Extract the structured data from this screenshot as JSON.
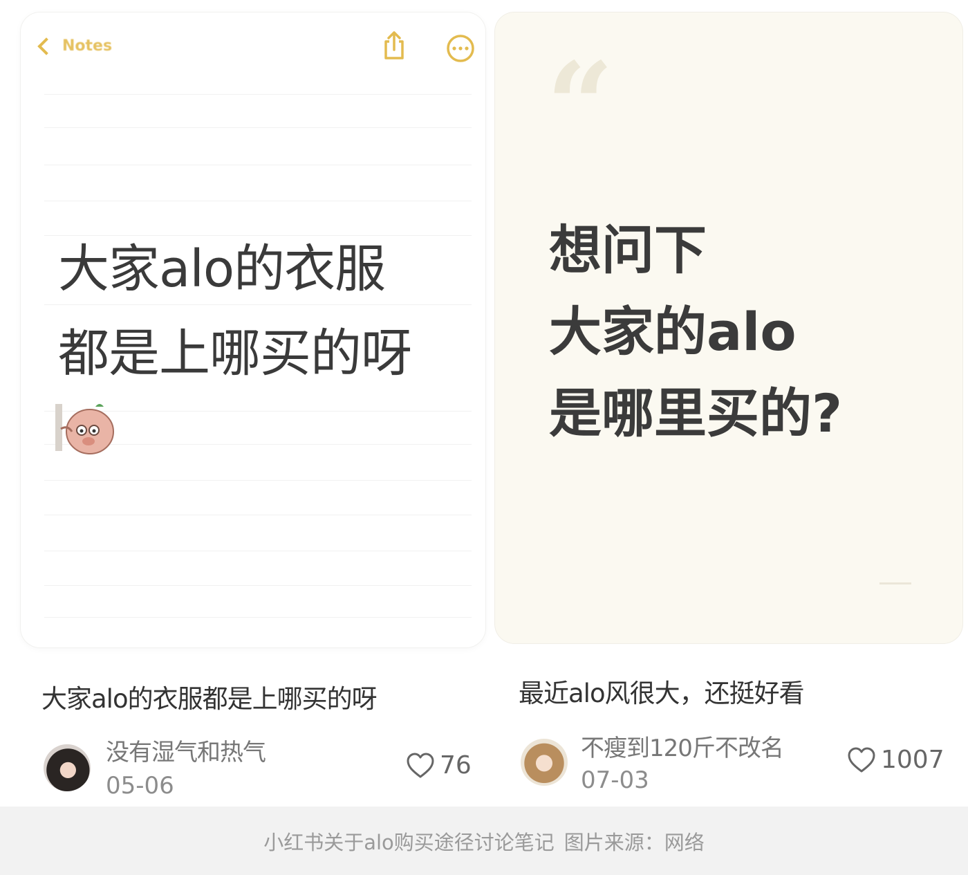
{
  "left_card": {
    "back_label": "Notes",
    "line1": "大家alo的衣服",
    "line2": "都是上哪买的呀"
  },
  "right_card": {
    "quote_glyph": "“",
    "line1": "想问下",
    "line2": "大家的alo",
    "line3": "是哪里买的?"
  },
  "posts": [
    {
      "title": "大家alo的衣服都是上哪买的呀",
      "author": "没有湿气和热气",
      "date": "05-06",
      "likes": "76"
    },
    {
      "title": "最近alo风很大，还挺好看",
      "author": "不瘦到120斤不改名",
      "date": "07-03",
      "likes": "1007"
    }
  ],
  "footer": {
    "caption": "小红书关于alo购买途径讨论笔记",
    "source": "图片来源：网络"
  },
  "colors": {
    "notes_accent": "#e3bb4f",
    "quote_card_bg": "#fbf9f1"
  }
}
